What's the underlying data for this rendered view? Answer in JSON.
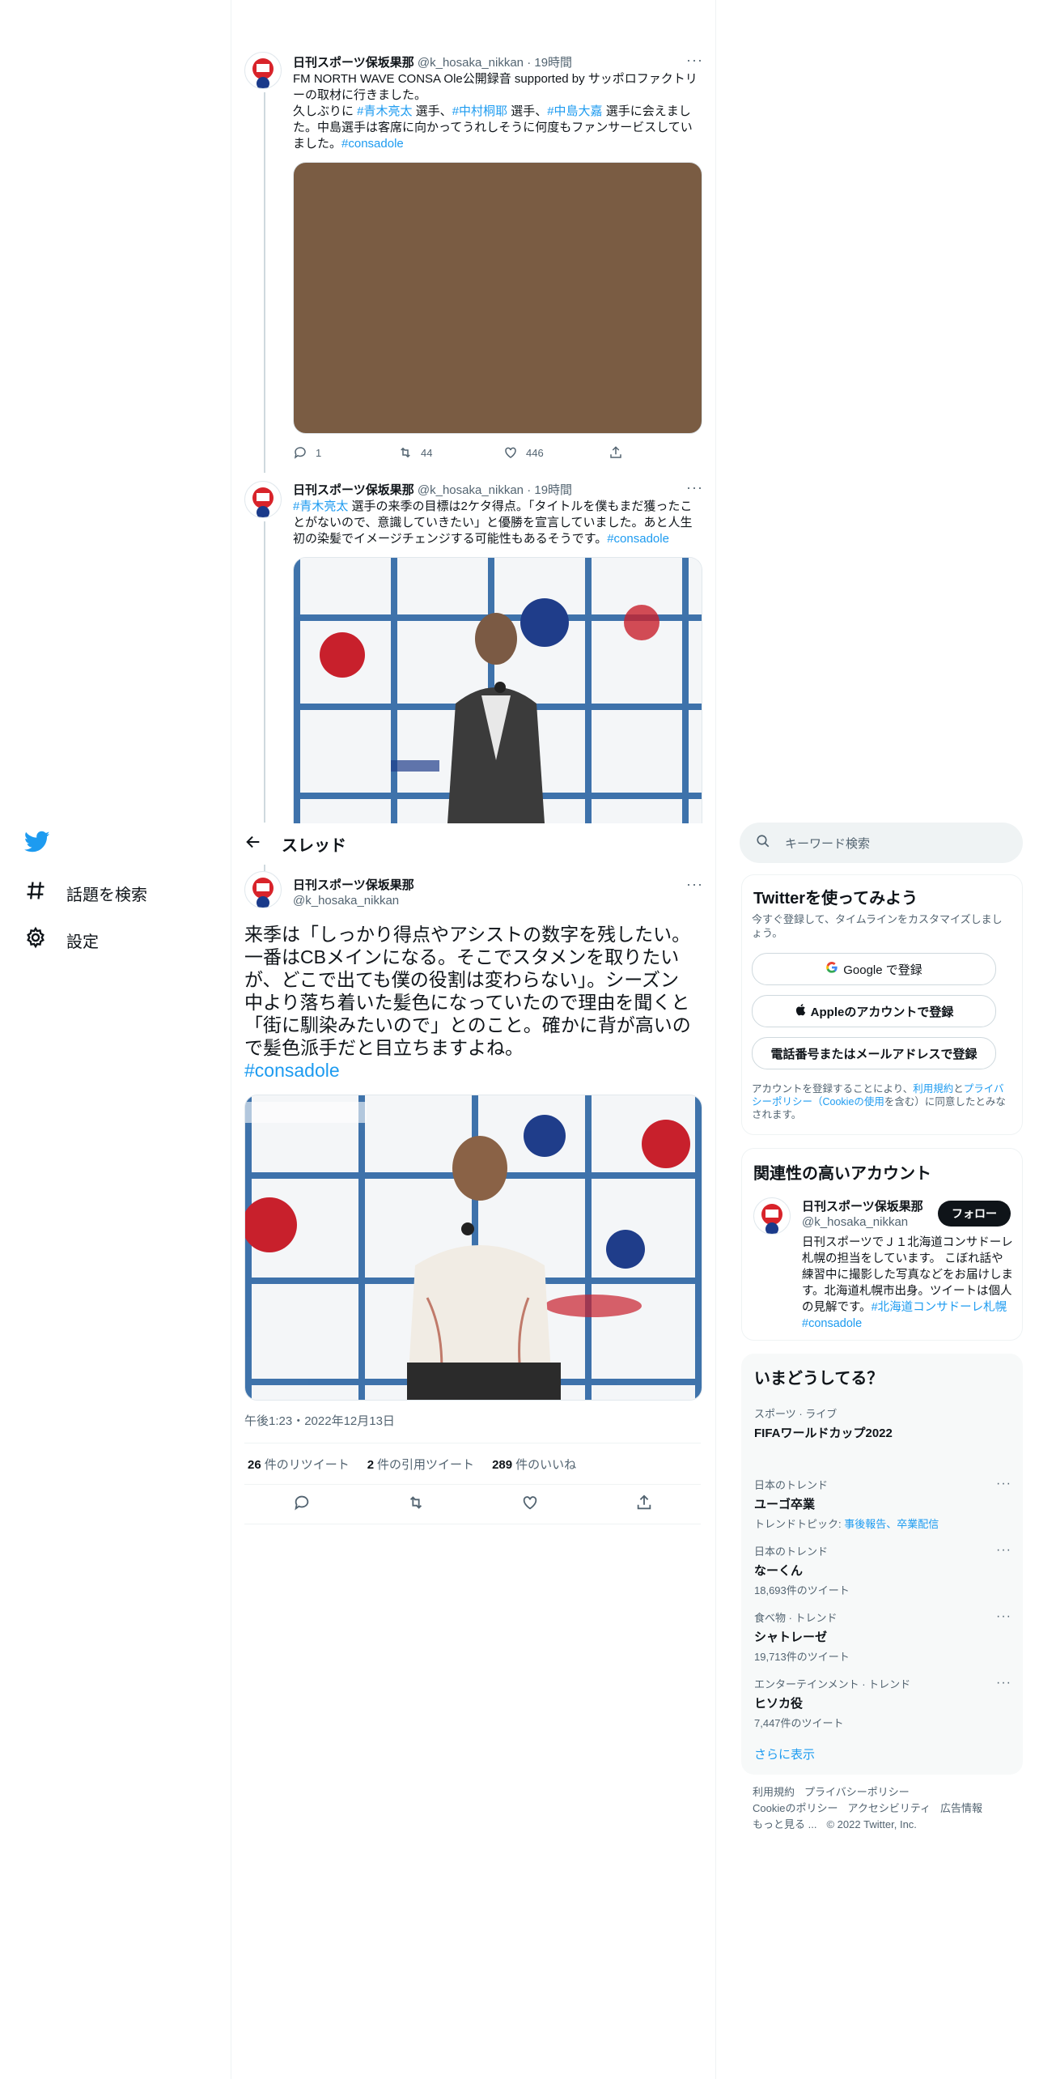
{
  "nav": {
    "items": [
      {
        "label": "話題を検索",
        "icon": "hashtag-icon"
      },
      {
        "label": "設定",
        "icon": "gear-icon"
      }
    ]
  },
  "tweets": [
    {
      "name": "日刊スポーツ保坂果那",
      "handle": "@k_hosaka_nikkan",
      "time": "· 19時間",
      "line1": "FM NORTH WAVE CONSA Ole公開録音 supported by サッポロファクトリーの取材に行きました。",
      "line2_pre": "久しぶりに ",
      "tag1": "#青木亮太",
      "mid1": " 選手、",
      "tag2": "#中村桐耶",
      "mid2": " 選手、",
      "tag3": "#中島大嘉",
      "line2_post": " 選手に会えました。中島選手は客席に向かってうれしそうに何度もファンサービスしていました。",
      "tag4": "#consadole",
      "replies": "1",
      "retweets": "44",
      "likes": "446"
    },
    {
      "name": "日刊スポーツ保坂果那",
      "handle": "@k_hosaka_nikkan",
      "time": "· 19時間",
      "tag1": "#青木亮太",
      "text": " 選手の来季の目標は2ケタ得点。「タイトルを僕もまだ獲ったことがないので、意識していきたい」と優勝を宣言していました。あと人生初の染髪でイメージチェンジする可能性もあるそうです。",
      "tag2": "#consadole"
    }
  ],
  "thread": {
    "title": "スレッド",
    "name": "日刊スポーツ保坂果那",
    "handle": "@k_hosaka_nikkan",
    "text": "来季は「しっかり得点やアシストの数字を残したい。一番はCBメインになる。そこでスタメンを取りたいが、どこで出ても僕の役割は変わらない」。シーズン中より落ち着いた髪色になっていたので理由を聞くと「街に馴染みたいので」とのこと。確かに背が高いので髪色派手だと目立ちますよね。",
    "hashtag": "#consadole",
    "timestamp": "午後1:23・2022年12月13日",
    "retweets": "26",
    "retweets_label": "件のリツイート",
    "quotes": "2",
    "quotes_label": "件の引用ツイート",
    "likes": "289",
    "likes_label": "件のいいね"
  },
  "search": {
    "placeholder": "キーワード検索"
  },
  "signup": {
    "title": "Twitterを使ってみよう",
    "desc": "今すぐ登録して、タイムラインをカスタマイズしましょう。",
    "google": "Google で登録",
    "apple": "Appleのアカウントで登録",
    "phone": "電話番号またはメールアドレスで登録",
    "legal_pre": "アカウントを登録することにより、",
    "terms": "利用規約",
    "and": "と",
    "privacy": "プライバシーポリシー（Cookieの使用",
    "legal_post": "を含む）に同意したとみなされます。"
  },
  "related": {
    "title": "関連性の高いアカウント",
    "name": "日刊スポーツ保坂果那",
    "handle": "@k_hosaka_nikkan",
    "follow": "フォロー",
    "bio": "日刊スポーツでＪ１北海道コンサドーレ札幌の担当をしています。 こぼれ話や練習中に撮影した写真などをお届けします。北海道札幌市出身。ツイートは個人の見解です。",
    "tag1": "#北海道コンサドーレ札幌",
    "tag2": "#consadole"
  },
  "trends": {
    "title": "いまどうしてる？",
    "items": [
      {
        "cat": "スポーツ · ライブ",
        "name": "FIFAワールドカップ2022",
        "sub": ""
      },
      {
        "cat": "日本のトレンド",
        "name": "ユーゴ卒業",
        "sub_pre": "トレンドトピック: ",
        "sub_links": "事後報告、卒業配信"
      },
      {
        "cat": "日本のトレンド",
        "name": "なーくん",
        "sub": "18,693件のツイート"
      },
      {
        "cat": "食べ物 · トレンド",
        "name": "シャトレーゼ",
        "sub": "19,713件のツイート"
      },
      {
        "cat": "エンターテインメント · トレンド",
        "name": "ヒソカ役",
        "sub": "7,447件のツイート"
      }
    ],
    "more": "さらに表示"
  },
  "footer": {
    "terms": "利用規約",
    "privacy": "プライバシーポリシー",
    "cookie": "Cookieのポリシー",
    "a11y": "アクセシビリティ",
    "ads": "広告情報",
    "more": "もっと見る ...",
    "copyright": "© 2022 Twitter, Inc."
  }
}
